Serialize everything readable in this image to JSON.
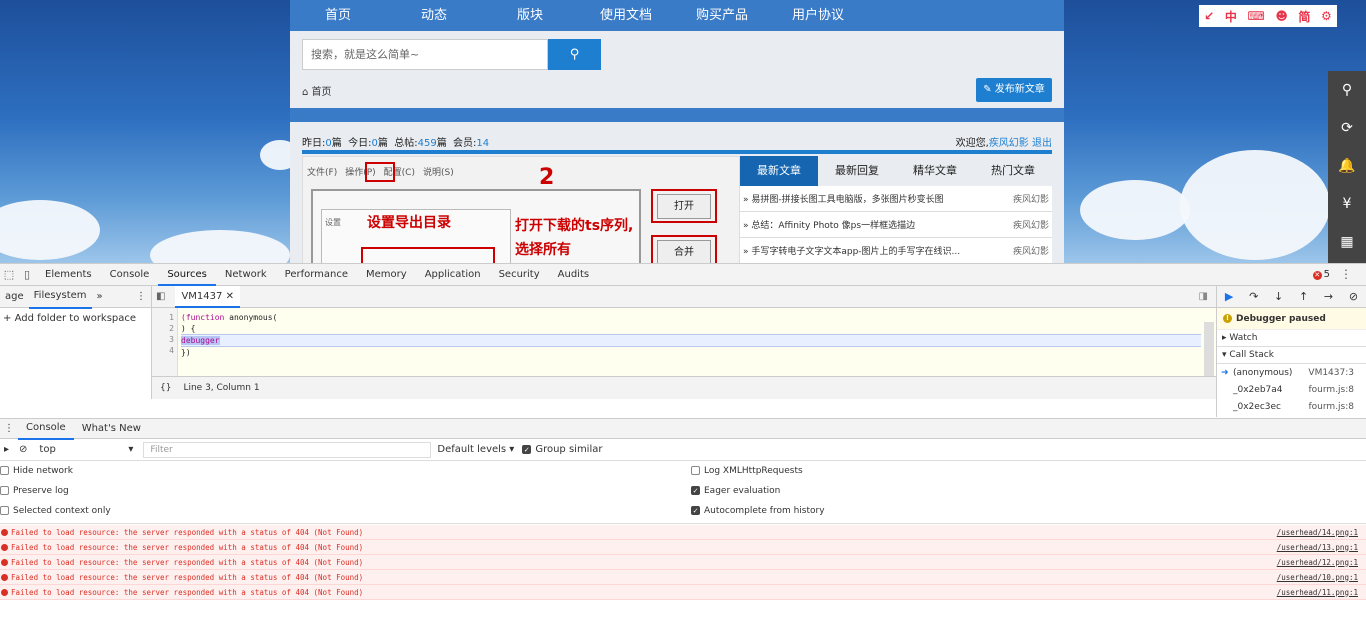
{
  "site": {
    "nav": [
      "首页",
      "动态",
      "版块",
      "使用文档",
      "购买产品",
      "用户协议"
    ],
    "search_placeholder": "搜索，就是这么简单~",
    "breadcrumb": "首页",
    "post_button": "发布新文章",
    "stats": {
      "yesterday_label": "昨日:",
      "yesterday": "0",
      "today_label": "今日:",
      "today": "0",
      "total_label": "总帖:",
      "total": "459",
      "members_label": "会员:",
      "members": "14",
      "unit": "篇"
    },
    "welcome": {
      "prefix": "欢迎您,",
      "user": "疾风幻影",
      "logout": "退出"
    },
    "screenshot": {
      "menu": [
        "文件(F)",
        "操作(P)",
        "配置(C)",
        "说明(S)"
      ],
      "setting_label": "设置",
      "open_btn": "打开",
      "merge_btn": "合并",
      "anno_1": "设置导出目录",
      "anno_2": "打开下载的ts序列,",
      "anno_3": "选择所有",
      "anno_num": "2"
    },
    "tabs": [
      "最新文章",
      "最新回复",
      "精华文章",
      "热门文章"
    ],
    "news": [
      {
        "title": "» 易拼图-拼接长图工具电脑版，多张图片秒变长图",
        "author": "疾风幻影"
      },
      {
        "title": "» 总结：Affinity Photo 像ps一样框选描边",
        "author": "疾风幻影"
      },
      {
        "title": "» 手写字转电子文字文本app-图片上的手写字在线识...",
        "author": "疾风幻影"
      }
    ],
    "toolbar_cn": [
      "↙",
      "中",
      "⌨",
      "☻",
      "简",
      "⚙"
    ],
    "sidebar_icons": [
      "⚲",
      "⟳",
      "🔔",
      "¥",
      "▦"
    ]
  },
  "devtools": {
    "tabs": [
      "Elements",
      "Console",
      "Sources",
      "Network",
      "Performance",
      "Memory",
      "Application",
      "Security",
      "Audits"
    ],
    "active_tab": "Sources",
    "error_count": "5",
    "nav_tabs": [
      "age",
      "Filesystem",
      "»"
    ],
    "add_folder": "Add folder to workspace",
    "file_tab": "VM1437",
    "lines": [
      "1",
      "2",
      "3",
      "4"
    ],
    "code": {
      "l1_kw": "(function",
      "l1_rest": " anonymous(",
      "l2": ") {",
      "l3": "debugger",
      "l4": "})"
    },
    "status": "Line 3, Column 1",
    "paused": "Debugger paused",
    "watch": "Watch",
    "call_stack": "Call Stack",
    "stack": [
      {
        "fn": "(anonymous)",
        "loc": "VM1437:3"
      },
      {
        "fn": "_0x2eb7a4",
        "loc": "fourm.js:8"
      },
      {
        "fn": "_0x2ec3ec",
        "loc": "fourm.js:8"
      }
    ],
    "drawer_tabs": [
      "Console",
      "What's New"
    ],
    "context": "top",
    "filter_placeholder": "Filter",
    "levels": "Default levels ▾",
    "group_similar": "Group similar",
    "options_left": [
      "Hide network",
      "Preserve log",
      "Selected context only"
    ],
    "options_right": [
      "Log XMLHttpRequests",
      "Eager evaluation",
      "Autocomplete from history"
    ],
    "messages": [
      {
        "text": "Failed to load resource: the server responded with a status of 404 (Not Found)",
        "src": "/userhead/14.png:1"
      },
      {
        "text": "Failed to load resource: the server responded with a status of 404 (Not Found)",
        "src": "/userhead/13.png:1"
      },
      {
        "text": "Failed to load resource: the server responded with a status of 404 (Not Found)",
        "src": "/userhead/12.png:1"
      },
      {
        "text": "Failed to load resource: the server responded with a status of 404 (Not Found)",
        "src": "/userhead/10.png:1"
      },
      {
        "text": "Failed to load resource: the server responded with a status of 404 (Not Found)",
        "src": "/userhead/11.png:1"
      }
    ]
  }
}
